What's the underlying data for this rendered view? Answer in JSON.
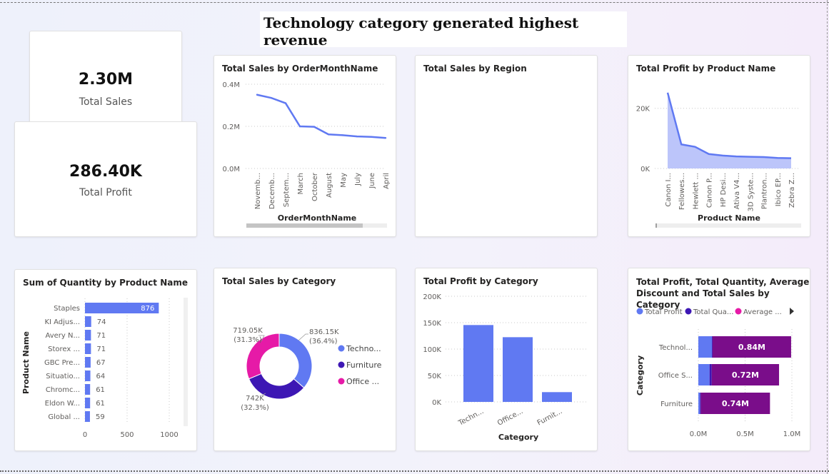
{
  "page": {
    "title": "Technology category generated highest revenue"
  },
  "kpis": [
    {
      "value": "2.30M",
      "label": "Total Sales"
    },
    {
      "value": "286.40K",
      "label": "Total Profit"
    }
  ],
  "colors": {
    "blue": "#6079f2",
    "dark_blue": "#3d17b4",
    "magenta": "#e61aa7",
    "purple": "#7a0d8a",
    "area_fill": "#bcc5fa"
  },
  "charts": {
    "sales_by_month": {
      "title": "Total Sales by OrderMonthName"
    },
    "sales_by_region": {
      "title": "Total Sales by Region"
    },
    "profit_by_product": {
      "title": "Total Profit by Product Name"
    },
    "qty_by_product": {
      "title": "Sum of Quantity by Product Name"
    },
    "sales_by_category": {
      "title": "Total Sales by Category"
    },
    "profit_by_category": {
      "title": "Total Profit by Category"
    },
    "combo_by_category": {
      "title_line1": "Total Profit, Total Quantity, Average",
      "title_line2": "Discount and Total Sales by Category"
    }
  },
  "chart_data": [
    {
      "id": "sales_by_month",
      "type": "line",
      "title": "Total Sales by OrderMonthName",
      "xlabel": "OrderMonthName",
      "ylabel": "",
      "categories": [
        "Novemb...",
        "Decemb...",
        "Septem...",
        "March",
        "October",
        "August",
        "May",
        "July",
        "June",
        "April"
      ],
      "values": [
        0.35,
        0.335,
        0.31,
        0.2,
        0.198,
        0.162,
        0.158,
        0.152,
        0.15,
        0.145
      ],
      "ylim": [
        0,
        0.4
      ],
      "yticks": [
        "0.0M",
        "0.2M",
        "0.4M"
      ],
      "grid": true
    },
    {
      "id": "sales_by_region",
      "type": "other",
      "title": "Total Sales by Region"
    },
    {
      "id": "profit_by_product",
      "type": "area",
      "title": "Total Profit by Product Name",
      "xlabel": "Product Name",
      "ylabel": "",
      "categories": [
        "Canon I...",
        "Fellowes...",
        "Hewlett ...",
        "Canon P...",
        "HP Desi...",
        "Ativa V4...",
        "3D Syste...",
        "Plantron...",
        "Ibico EP...",
        "Zebra Z..."
      ],
      "values": [
        25200,
        8000,
        7200,
        4800,
        4300,
        4000,
        3900,
        3800,
        3500,
        3400
      ],
      "ylim": [
        0,
        28000
      ],
      "yticks": [
        "0K",
        "20K"
      ],
      "grid": true
    },
    {
      "id": "qty_by_product",
      "type": "bar",
      "orientation": "horizontal",
      "title": "Sum of Quantity by Product Name",
      "xlabel": "",
      "ylabel": "Product Name",
      "categories": [
        "Staples",
        "KI Adjus...",
        "Avery N...",
        "Storex ...",
        "GBC Pre...",
        "Situatio...",
        "Chromc...",
        "Eldon W...",
        "Global ..."
      ],
      "values": [
        876,
        74,
        71,
        71,
        67,
        64,
        61,
        61,
        59
      ],
      "xlim": [
        0,
        1000
      ],
      "xticks": [
        "0",
        "500",
        "1000"
      ]
    },
    {
      "id": "sales_by_category",
      "type": "pie",
      "donut": true,
      "title": "Total Sales by Category",
      "categories": [
        "Technology",
        "Furniture",
        "Office Supplies"
      ],
      "legend": [
        "Techno...",
        "Furniture",
        "Office ..."
      ],
      "values": [
        836.15,
        742,
        719.05
      ],
      "value_labels": [
        "836.15K",
        "742K",
        "719.05K"
      ],
      "percent_labels": [
        "(36.4%)",
        "(32.3%)",
        "(31.3%)"
      ],
      "legend_position": "right"
    },
    {
      "id": "profit_by_category",
      "type": "bar",
      "title": "Total Profit by Category",
      "xlabel": "Category",
      "ylabel": "",
      "categories": [
        "Techn...",
        "Office...",
        "Furnit..."
      ],
      "values": [
        145500,
        122500,
        18500
      ],
      "ylim": [
        0,
        200000
      ],
      "yticks": [
        "0K",
        "50K",
        "100K",
        "150K",
        "200K"
      ],
      "grid": true
    },
    {
      "id": "combo_by_category",
      "type": "bar",
      "orientation": "horizontal",
      "stacked": true,
      "title": "Total Profit, Total Quantity, Average Discount and Total Sales by Category",
      "xlabel": "",
      "ylabel": "Category",
      "categories": [
        "Technol...",
        "Office S...",
        "Furniture"
      ],
      "series": [
        {
          "name": "Total Profit",
          "values": [
            0.145,
            0.12,
            0.018
          ]
        },
        {
          "name": "Total Qua...",
          "values": [
            0.007,
            0.023,
            0.008
          ]
        },
        {
          "name": "Average ...",
          "values": [
            0.0,
            0.0,
            0.0
          ]
        },
        {
          "name": "Total Sales",
          "values": [
            0.84,
            0.72,
            0.74
          ]
        }
      ],
      "data_labels": [
        "0.84M",
        "0.72M",
        "0.74M"
      ],
      "legend": [
        "Total Profit",
        "Total Qua...",
        "Average ..."
      ],
      "xlim": [
        0,
        1.0
      ],
      "xticks": [
        "0.0M",
        "0.5M",
        "1.0M"
      ],
      "legend_position": "top"
    }
  ]
}
